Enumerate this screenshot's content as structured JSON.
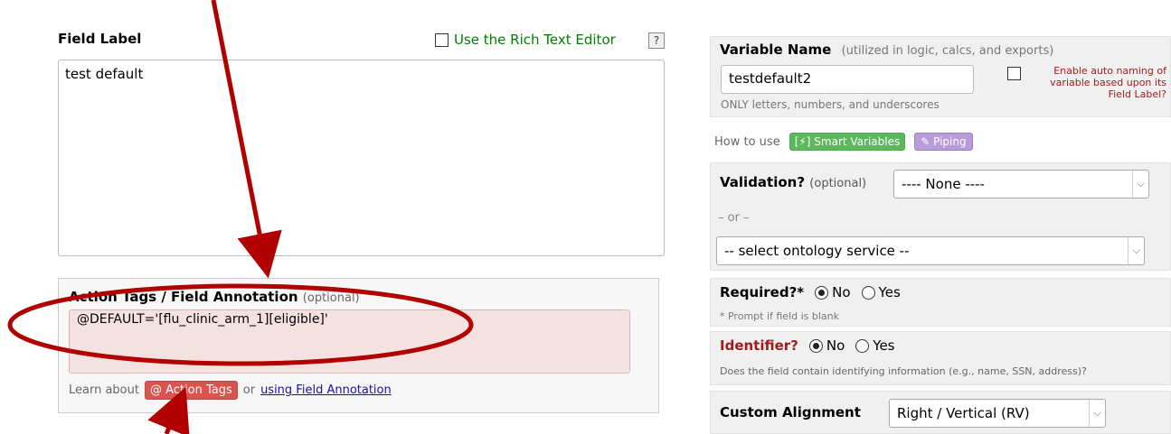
{
  "field_label": {
    "title": "Field Label",
    "rich_text_label": "Use the Rich Text Editor",
    "help": "?",
    "value": "test default"
  },
  "action_tags": {
    "title": "Action Tags / Field Annotation",
    "optional": "(optional)",
    "value": "@DEFAULT='[flu_clinic_arm_1][eligible]'",
    "learn_about": "Learn about",
    "action_tags_button": "@ Action Tags",
    "or": "or",
    "field_annotation_link": "using Field Annotation"
  },
  "variable_name": {
    "title": "Variable Name",
    "hint": "(utilized in logic, calcs, and exports)",
    "value": "testdefault2",
    "only_letters": "ONLY letters, numbers, and underscores",
    "auto_naming": "Enable auto naming of variable based upon its Field Label?"
  },
  "how_to_use": {
    "label": "How to use",
    "smart_variables": "[⚡] Smart Variables",
    "piping": "✎ Piping"
  },
  "validation": {
    "label": "Validation?",
    "optional": "(optional)",
    "selected": "---- None ----",
    "or": "– or –",
    "ontology_selected": "-- select ontology service --"
  },
  "required": {
    "label": "Required?*",
    "no": "No",
    "yes": "Yes",
    "hint": "* Prompt if field is blank"
  },
  "identifier": {
    "label": "Identifier?",
    "no": "No",
    "yes": "Yes",
    "hint": "Does the field contain identifying information (e.g., name, SSN, address)?"
  },
  "alignment": {
    "label": "Custom Alignment",
    "selected": "Right / Vertical (RV)"
  },
  "colors": {
    "annotation_red": "#b00000",
    "action_tag_button": "#d9534f",
    "smart_variables": "#5cb85c",
    "piping": "#b99bd9",
    "rich_text_green": "#008000"
  }
}
